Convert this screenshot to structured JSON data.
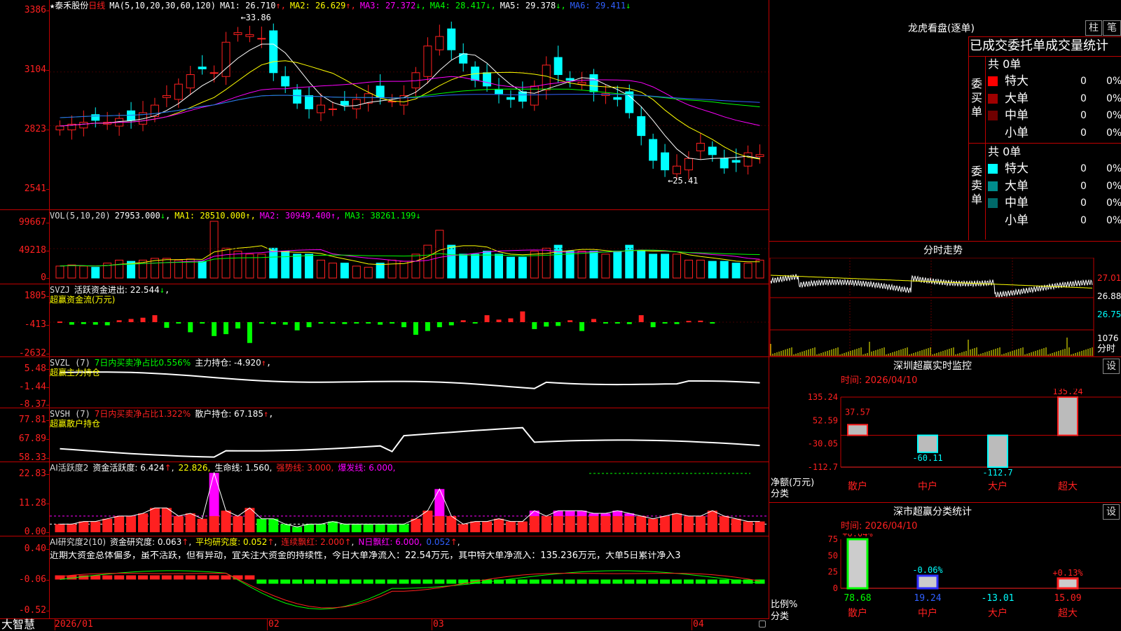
{
  "stock": {
    "star": "★",
    "name": "泰禾股份",
    "period": "日线"
  },
  "price_header": {
    "ma_label": "MA(5,10,20,30,60,120)",
    "items": [
      {
        "k": "MA1: ",
        "v": "26.710",
        "a": "↑",
        "c": "#ffffff"
      },
      {
        "k": "MA2: ",
        "v": "26.629",
        "a": "↑",
        "c": "#ffff00"
      },
      {
        "k": "MA3: ",
        "v": "27.372",
        "a": "↓",
        "c": "#ff00ff"
      },
      {
        "k": "MA4: ",
        "v": "28.417",
        "a": "↓",
        "c": "#00ff00"
      },
      {
        "k": "MA5: ",
        "v": "29.378",
        "a": "↓",
        "c": "#ffffff"
      },
      {
        "k": "MA6: ",
        "v": "29.411",
        "a": "↓",
        "c": "#3060ff"
      }
    ]
  },
  "y_axis": {
    "price": [
      "3386",
      "3104",
      "2823",
      "2541"
    ],
    "vol": [
      "99667",
      "49218",
      "0"
    ],
    "svzj": [
      "1805",
      "-413",
      "-2632"
    ],
    "svzl": [
      "5.48",
      "-1.44",
      "-8.37"
    ],
    "svsh": [
      "77.81",
      "67.89",
      "58.33"
    ],
    "ai1": [
      "22.83",
      "11.28",
      "0.00"
    ],
    "ai2": [
      "0.40",
      "-0.06",
      "-0.52"
    ]
  },
  "annotations": {
    "high": "←33.86",
    "low": "←25.41"
  },
  "vol_header": {
    "label": "VOL(5,10,20)",
    "value": "27953.000",
    "arrow": "↓",
    "ma1": "MA1: 28510.000↑,",
    "ma2": "MA2: 30949.400↑,",
    "ma3": "MA3: 38261.199↓"
  },
  "svzj_header": {
    "label": "SVZJ",
    "text": "活跃资金进出: 22.544",
    "arrow": "↓",
    "comma": ",",
    "sub": "超赢资金流(万元)"
  },
  "svzl_header": {
    "label": "SVZL (7)",
    "pct": "7日内买卖净占比0.556%",
    "text": "主力持仓: -4.920",
    "arrow": "↑",
    "comma": ",",
    "sub": "超赢主力持仓"
  },
  "svsh_header": {
    "label": "SVSH (7)",
    "pct": "7日内买卖净占比1.322%",
    "text": "散户持仓: 67.185",
    "arrow": "↑",
    "comma": ",",
    "sub": "超赢散户持仓"
  },
  "ai1_header": {
    "label": "AI活跃度2",
    "t1": "资金活跃度: 6.424",
    "a1": "↑",
    "t2": "22.826,",
    "t3": "生命线: 1.560,",
    "t4": "强势线: 3.000,",
    "t5": "爆发线: 6.000,"
  },
  "ai2_header": {
    "label": "AI研究度2(10)",
    "t1": "资金研究度: 0.063",
    "a1": "↑",
    "t2": "平均研究度: 0.052",
    "a2": "↑",
    "t3": "连续飘红: 2.000",
    "a3": "↑",
    "t4": "N日飘红: 6.000,",
    "t5": "0.052",
    "a5": "↑",
    "comment": "近期大资金总体偏多，虽不活跃，但有异动，宜关注大资金的持续性，今日大单净流入：22.54万元，其中特大单净流入：135.236万元，大单5日累计净入3"
  },
  "dates": [
    "2026/01",
    "02",
    "03",
    "04"
  ],
  "logo": "大智慧",
  "right": {
    "lhkp_title": "龙虎看盘(逐单)",
    "btn_zhu": "柱",
    "btn_bi": "笔",
    "stat_title": "已成交委托单成交量统计",
    "buy": {
      "label": "委买单",
      "total": "共 0单",
      "rows": [
        {
          "name": "特大",
          "v": "0",
          "p": "0%",
          "c": "#ff0000"
        },
        {
          "name": "大单",
          "v": "0",
          "p": "0%",
          "c": "#a00000"
        },
        {
          "name": "中单",
          "v": "0",
          "p": "0%",
          "c": "#700000"
        },
        {
          "name": "小单",
          "v": "0",
          "p": "0%",
          "c": "#000000"
        }
      ]
    },
    "sell": {
      "label": "委卖单",
      "total": "共 0单",
      "rows": [
        {
          "name": "特大",
          "v": "0",
          "p": "0%",
          "c": "#00ffff"
        },
        {
          "name": "大单",
          "v": "0",
          "p": "0%",
          "c": "#008c8c"
        },
        {
          "name": "中单",
          "v": "0",
          "p": "0%",
          "c": "#006a6a"
        },
        {
          "name": "小单",
          "v": "0",
          "p": "0%",
          "c": "#000000"
        }
      ]
    },
    "fenshi_title": "分时走势",
    "fenshi_y": [
      "27.01",
      "26.88",
      "26.75"
    ],
    "fenshi_vol": "1076",
    "fenshi_unit": "分时",
    "monitor_title": "深圳超赢实时监控",
    "monitor_btn": "设",
    "monitor_time": "时间: 2026/04/10",
    "monitor_y": [
      "135.24",
      "52.59",
      "-30.05",
      "-112.7"
    ],
    "monitor_unit": "净额(万元)",
    "monitor_cat": "分类",
    "class_title": "深市超赢分类统计",
    "class_btn": "设",
    "class_time": "时间: 2026/04/10",
    "class_y": [
      "75",
      "50",
      "25",
      "0"
    ],
    "class_unit": "比例%",
    "class_cat": "分类",
    "class_bottom": [
      "78.68",
      "19.24",
      "-13.01",
      "15.09"
    ]
  },
  "chart_data": [
    {
      "type": "bar",
      "title": "深圳超赢实时监控",
      "categories": [
        "散户",
        "中户",
        "大户",
        "超大"
      ],
      "values": [
        37.57,
        -60.11,
        -112.7,
        135.24
      ],
      "labels": [
        "37.57",
        "-60.11",
        "-112.7",
        "135.24"
      ],
      "ylim": [
        -112.7,
        135.24
      ],
      "colors": [
        "#ff2020",
        "#00ffff",
        "#00ffff",
        "#ff2020"
      ]
    },
    {
      "type": "bar",
      "title": "深市超赢分类统计",
      "categories": [
        "散户",
        "中户",
        "大户",
        "超大"
      ],
      "values": [
        78.68,
        19.24,
        0,
        15.09
      ],
      "labels": [
        "+0.04%",
        "-0.06%",
        "",
        "+0.13%"
      ],
      "ylim": [
        0,
        75
      ],
      "colors": [
        "#00ff00",
        "#3030ff",
        "#00ffff",
        "#ff2020"
      ]
    },
    {
      "type": "bar",
      "title": "超赢资金流(万元)",
      "ylim": [
        -2632,
        1805
      ],
      "values": [
        50,
        -200,
        -150,
        -200,
        -250,
        150,
        250,
        350,
        550,
        -450,
        -50,
        -800,
        -100,
        -1100,
        -950,
        -500,
        -1650,
        -50,
        -150,
        -200,
        -650,
        -400,
        -50,
        -100,
        -150,
        -100,
        -50,
        -200,
        -50,
        -400,
        -1000,
        -700,
        -400,
        -250,
        150,
        -100,
        550,
        200,
        300,
        850,
        -550,
        -350,
        -300,
        150,
        -700,
        250,
        -50,
        -100,
        -150,
        550,
        -400,
        -50,
        -150,
        100,
        120,
        -100
      ],
      "up_color": "#ff2020",
      "down_color": "#00ff00"
    },
    {
      "type": "bar",
      "title": "AI活跃度2",
      "ylim": [
        0,
        22.83
      ],
      "values": [
        3,
        3,
        4,
        4,
        5,
        6,
        6,
        7,
        9,
        9,
        6,
        7,
        5,
        22,
        8,
        6,
        9,
        5,
        5,
        3,
        2,
        3,
        3,
        4,
        3,
        3,
        3,
        3,
        3,
        3,
        5,
        8,
        16,
        6,
        3,
        4,
        4,
        5,
        4,
        4,
        8,
        6,
        8,
        8,
        8,
        7,
        7,
        8,
        7,
        6,
        5,
        6,
        7,
        6,
        6,
        8,
        6,
        5,
        4,
        4,
        3,
        4,
        6,
        6
      ],
      "colors_seq": "mix",
      "ref_lines": {
        "生命线": 1.56,
        "强势线": 3.0,
        "爆发线": 6.0
      }
    }
  ]
}
